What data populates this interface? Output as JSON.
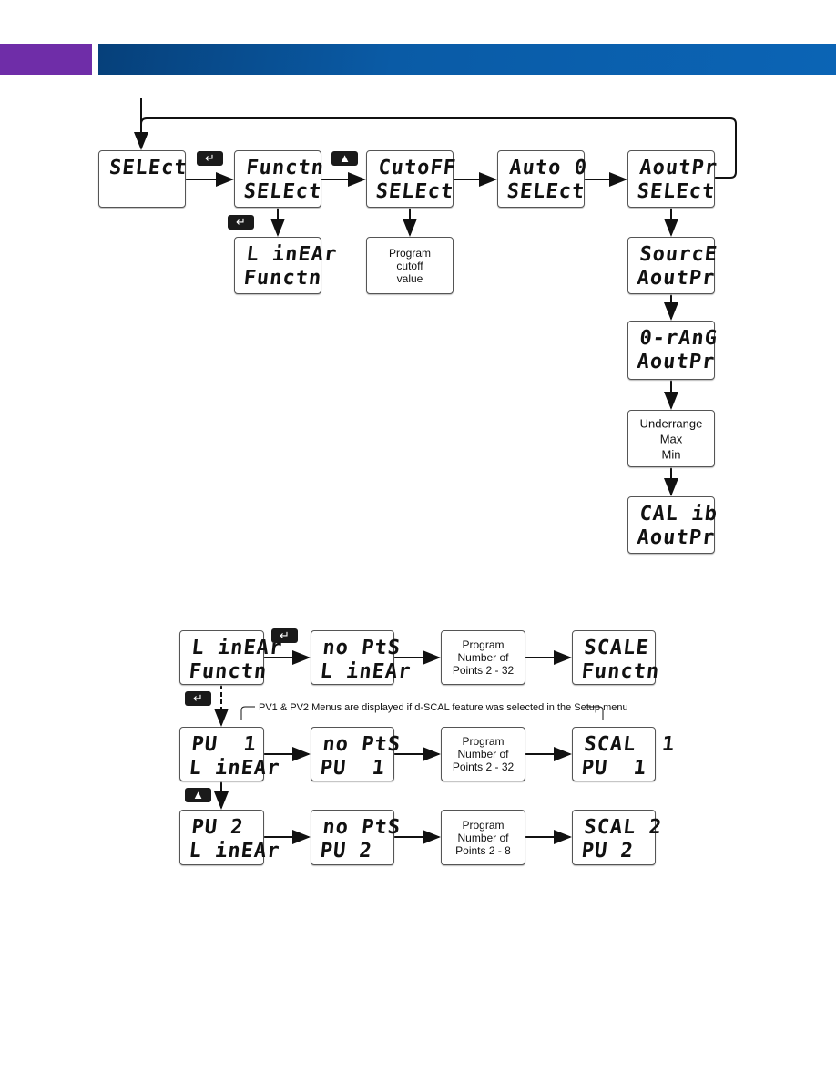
{
  "header": {
    "accent_left": "#6f2da8",
    "accent_right": "#0b64b5"
  },
  "top_flow": {
    "select": {
      "line1": "SELEct",
      "line2": ""
    },
    "functn_select": {
      "line1": "Functn",
      "line2": "SELEct"
    },
    "cutoff_select": {
      "line1": "CutoFF",
      "line2": "SELEct"
    },
    "auto0_select": {
      "line1": "Auto 0",
      "line2": "SELEct"
    },
    "aoutpr_select": {
      "line1": "AoutPr",
      "line2": "SELEct"
    },
    "linear_functn": {
      "line1": "L inEAr",
      "line2": "Functn"
    },
    "program_cutoff": {
      "text": "Program\ncutoff\nvalue"
    },
    "source_aoutpr": {
      "line1": "SourcE",
      "line2": "AoutPr"
    },
    "orang_aoutpr": {
      "line1": "0-rAnG",
      "line2": "AoutPr"
    },
    "underrange": {
      "text": "Underrange\nMax\nMin"
    },
    "calib_aoutpr": {
      "line1": "CAL ib",
      "line2": "AoutPr"
    }
  },
  "bottom_flow": {
    "note": "PV1 & PV2 Menus are displayed if d-SCAL feature was selected in the Setup menu",
    "rows": [
      {
        "a": {
          "line1": "L inEAr",
          "line2": "Functn"
        },
        "b": {
          "line1": "no PtS",
          "line2": "L inEAr"
        },
        "c": "Program\nNumber of\nPoints 2 - 32",
        "d": {
          "line1": "SCALE",
          "line2": "Functn"
        }
      },
      {
        "a": {
          "line1": "PU  1",
          "line2": "L inEAr"
        },
        "b": {
          "line1": "no PtS",
          "line2": "PU  1"
        },
        "c": "Program\nNumber of\nPoints 2 - 32",
        "d": {
          "line1": "SCAL  1",
          "line2": "PU  1"
        }
      },
      {
        "a": {
          "line1": "PU 2",
          "line2": "L inEAr"
        },
        "b": {
          "line1": "no PtS",
          "line2": "PU 2"
        },
        "c": "Program\nNumber of\nPoints 2 - 8",
        "d": {
          "line1": "SCAL 2",
          "line2": "PU 2"
        }
      }
    ]
  },
  "keys": {
    "enter": "↵",
    "up": "▲"
  }
}
